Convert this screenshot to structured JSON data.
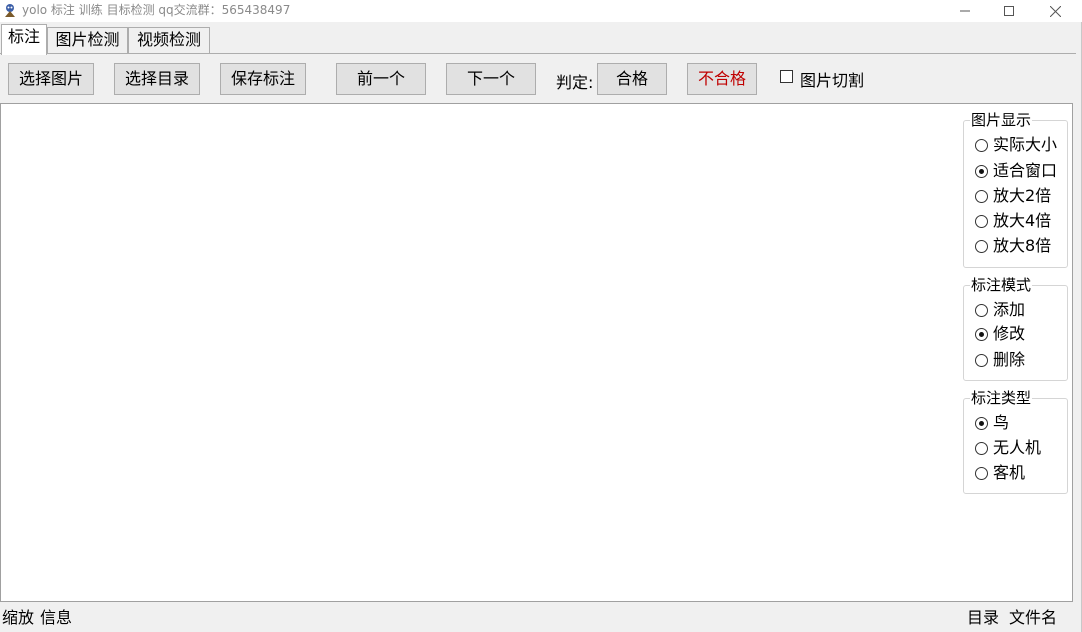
{
  "window": {
    "title": "yolo 标注 训练 目标检测  qq交流群：565438497"
  },
  "tabs": [
    {
      "label": "标注",
      "active": true
    },
    {
      "label": "图片检测",
      "active": false
    },
    {
      "label": "视频检测",
      "active": false
    }
  ],
  "toolbar": {
    "select_image": "选择图片",
    "select_dir": "选择目录",
    "save_annotation": "保存标注",
    "prev": "前一个",
    "next": "下一个",
    "judge_label": "判定:",
    "pass": "合格",
    "fail": "不合格",
    "crop_label": "图片切割",
    "crop_checked": false,
    "fail_color": "#c00000"
  },
  "panels": {
    "display": {
      "title": "图片显示",
      "options": [
        "实际大小",
        "适合窗口",
        "放大2倍",
        "放大4倍",
        "放大8倍"
      ],
      "selected": 1
    },
    "mode": {
      "title": "标注模式",
      "options": [
        "添加",
        "修改",
        "删除"
      ],
      "selected": 1
    },
    "type": {
      "title": "标注类型",
      "options": [
        "鸟",
        "无人机",
        "客机"
      ],
      "selected": 0
    }
  },
  "status": {
    "zoom": "缩放",
    "info": "信息",
    "dir": "目录",
    "filename": "文件名"
  }
}
